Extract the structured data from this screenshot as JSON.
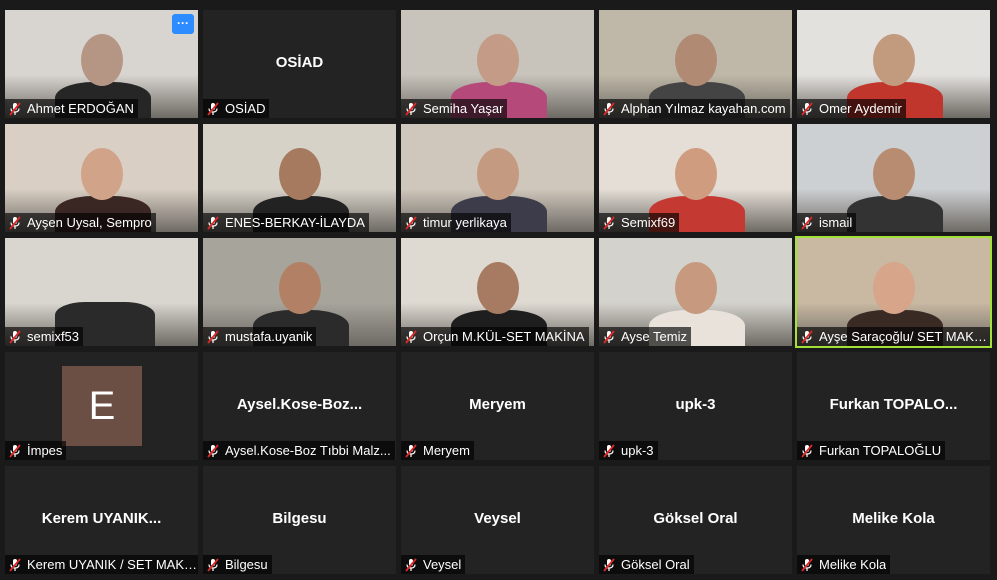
{
  "participants": [
    {
      "name": "Ahmet ERDOĞAN",
      "video": true,
      "palette": [
        "#d8d4cf",
        "#b59685",
        "#262626"
      ],
      "has_more_button": true
    },
    {
      "name": "OSİAD",
      "display": "OSİAD",
      "video": false
    },
    {
      "name": "Semiha Yaşar",
      "video": true,
      "palette": [
        "#c8c4bc",
        "#c49b86",
        "#b54a7a"
      ]
    },
    {
      "name": "Alphan Yılmaz kayahan.com",
      "video": true,
      "palette": [
        "#bfb8a8",
        "#b08a72",
        "#444444"
      ]
    },
    {
      "name": "Omer Aydemir",
      "video": true,
      "palette": [
        "#e3e1de",
        "#c29a7d",
        "#c0362c"
      ]
    },
    {
      "name": "Ayşen Uysal, Sempro",
      "video": true,
      "palette": [
        "#d9cfc4",
        "#d1a48a",
        "#3a2622"
      ]
    },
    {
      "name": "ENES-BERKAY-İLAYDA",
      "video": true,
      "palette": [
        "#d6d2c8",
        "#a57a5e",
        "#222222"
      ]
    },
    {
      "name": "timur yerlikaya",
      "video": true,
      "palette": [
        "#cfc7bc",
        "#c49a80",
        "#3c3c4a"
      ]
    },
    {
      "name": "Semixf69",
      "video": true,
      "palette": [
        "#e4ded6",
        "#cf9c80",
        "#c43a32"
      ]
    },
    {
      "name": "ismail",
      "video": true,
      "palette": [
        "#cdd0d2",
        "#b88c70",
        "#333333"
      ]
    },
    {
      "name": "semixf53",
      "video": true,
      "palette": [
        "#d9d6d0",
        "#d9d6d0",
        "#2a2a2a"
      ]
    },
    {
      "name": "mustafa.uyanik",
      "video": true,
      "palette": [
        "#a7a49c",
        "#b28064",
        "#2b2b2b"
      ]
    },
    {
      "name": "Orçun M.KÜL-SET MAKİNA",
      "video": true,
      "palette": [
        "#dedad2",
        "#a77b62",
        "#1e1e1e"
      ]
    },
    {
      "name": "Ayse Temiz",
      "video": true,
      "palette": [
        "#d4d2cc",
        "#c79a80",
        "#e8e2da"
      ]
    },
    {
      "name": "Ayşe Saraçoğlu/ SET MAKINA",
      "video": true,
      "active_speaker": true,
      "palette": [
        "#c9b8a2",
        "#d6a58a",
        "#3a2a24"
      ]
    },
    {
      "name": "İmpes",
      "video": false,
      "avatar_letter": "E"
    },
    {
      "name": "Aysel.Kose-Boz Tıbbi Malz...",
      "display": "Aysel.Kose-Boz...",
      "video": false
    },
    {
      "name": "Meryem",
      "display": "Meryem",
      "video": false
    },
    {
      "name": "upk-3",
      "display": "upk-3",
      "video": false
    },
    {
      "name": "Furkan TOPALOĞLU",
      "display": "Furkan  TOPALO...",
      "video": false
    },
    {
      "name": "Kerem UYANIK / SET MAKİ...",
      "display": "Kerem  UYANIK...",
      "video": false
    },
    {
      "name": "Bilgesu",
      "display": "Bilgesu",
      "video": false
    },
    {
      "name": "Veysel",
      "display": "Veysel",
      "video": false
    },
    {
      "name": "Göksel Oral",
      "display": "Göksel Oral",
      "video": false
    },
    {
      "name": "Melike Kola",
      "display": "Melike Kola",
      "video": false
    }
  ],
  "more_button_label": "···",
  "colors": {
    "active_border": "#a4e03a",
    "mic_muted": "#e02828",
    "more_button": "#2d8cff"
  },
  "icons": {
    "mic": "muted-microphone-icon"
  }
}
